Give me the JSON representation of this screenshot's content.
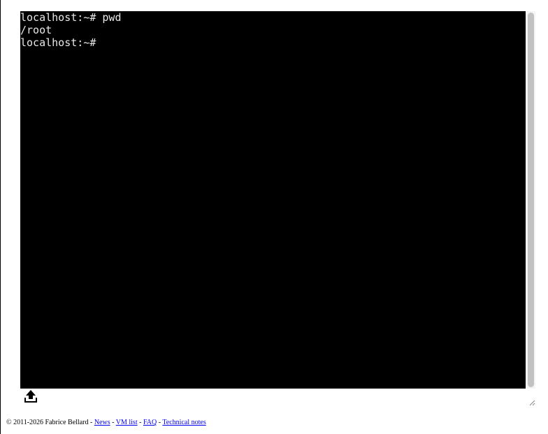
{
  "terminal": {
    "lines": [
      "localhost:~# pwd",
      "/root",
      "localhost:~# "
    ]
  },
  "upload": {
    "icon": "upload-icon"
  },
  "footer": {
    "copyright": "© 2011-2026 Fabrice Bellard",
    "sep": " - ",
    "links": [
      "News",
      "VM list",
      "FAQ",
      "Technical notes"
    ]
  },
  "colors": {
    "terminal_bg": "#000000",
    "terminal_fg": "#e8e8e8",
    "link": "#0000ee"
  }
}
